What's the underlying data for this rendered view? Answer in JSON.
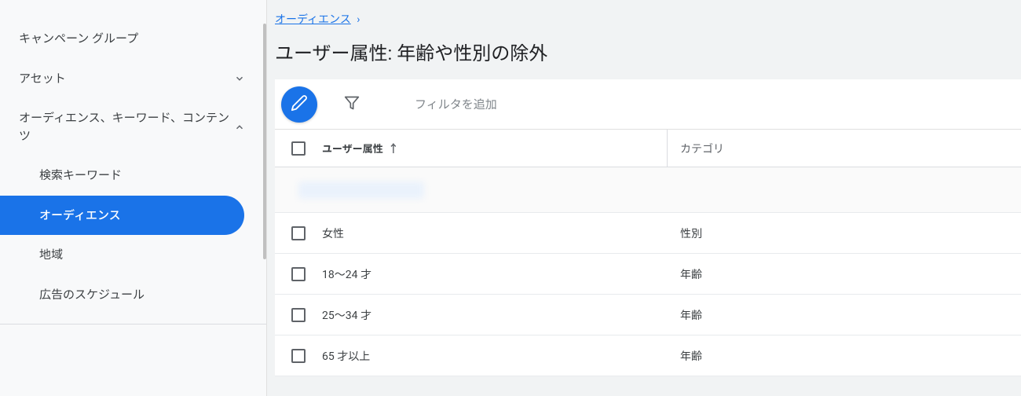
{
  "sidebar": {
    "items": [
      {
        "label": "キャンペーン グループ",
        "type": "item"
      },
      {
        "label": "アセット",
        "type": "collapsible",
        "state": "collapsed"
      },
      {
        "label": "オーディエンス、キーワード、コンテンツ",
        "type": "collapsible",
        "state": "expanded"
      },
      {
        "label": "検索キーワード",
        "type": "subitem"
      },
      {
        "label": "オーディエンス",
        "type": "subitem",
        "active": true
      },
      {
        "label": "地域",
        "type": "subitem"
      },
      {
        "label": "広告のスケジュール",
        "type": "subitem"
      }
    ]
  },
  "breadcrumb": {
    "link_label": "オーディエンス",
    "separator": "›"
  },
  "page_title": "ユーザー属性: 年齢や性別の除外",
  "toolbar": {
    "filter_placeholder": "フィルタを追加"
  },
  "table": {
    "columns": {
      "attribute": "ユーザー属性",
      "category": "カテゴリ"
    },
    "sort_indicator": "↑",
    "rows": [
      {
        "attr": "女性",
        "category": "性別"
      },
      {
        "attr": "18～24 才",
        "category": "年齢"
      },
      {
        "attr": "25～34 才",
        "category": "年齢"
      },
      {
        "attr": "65 才以上",
        "category": "年齢"
      }
    ]
  }
}
